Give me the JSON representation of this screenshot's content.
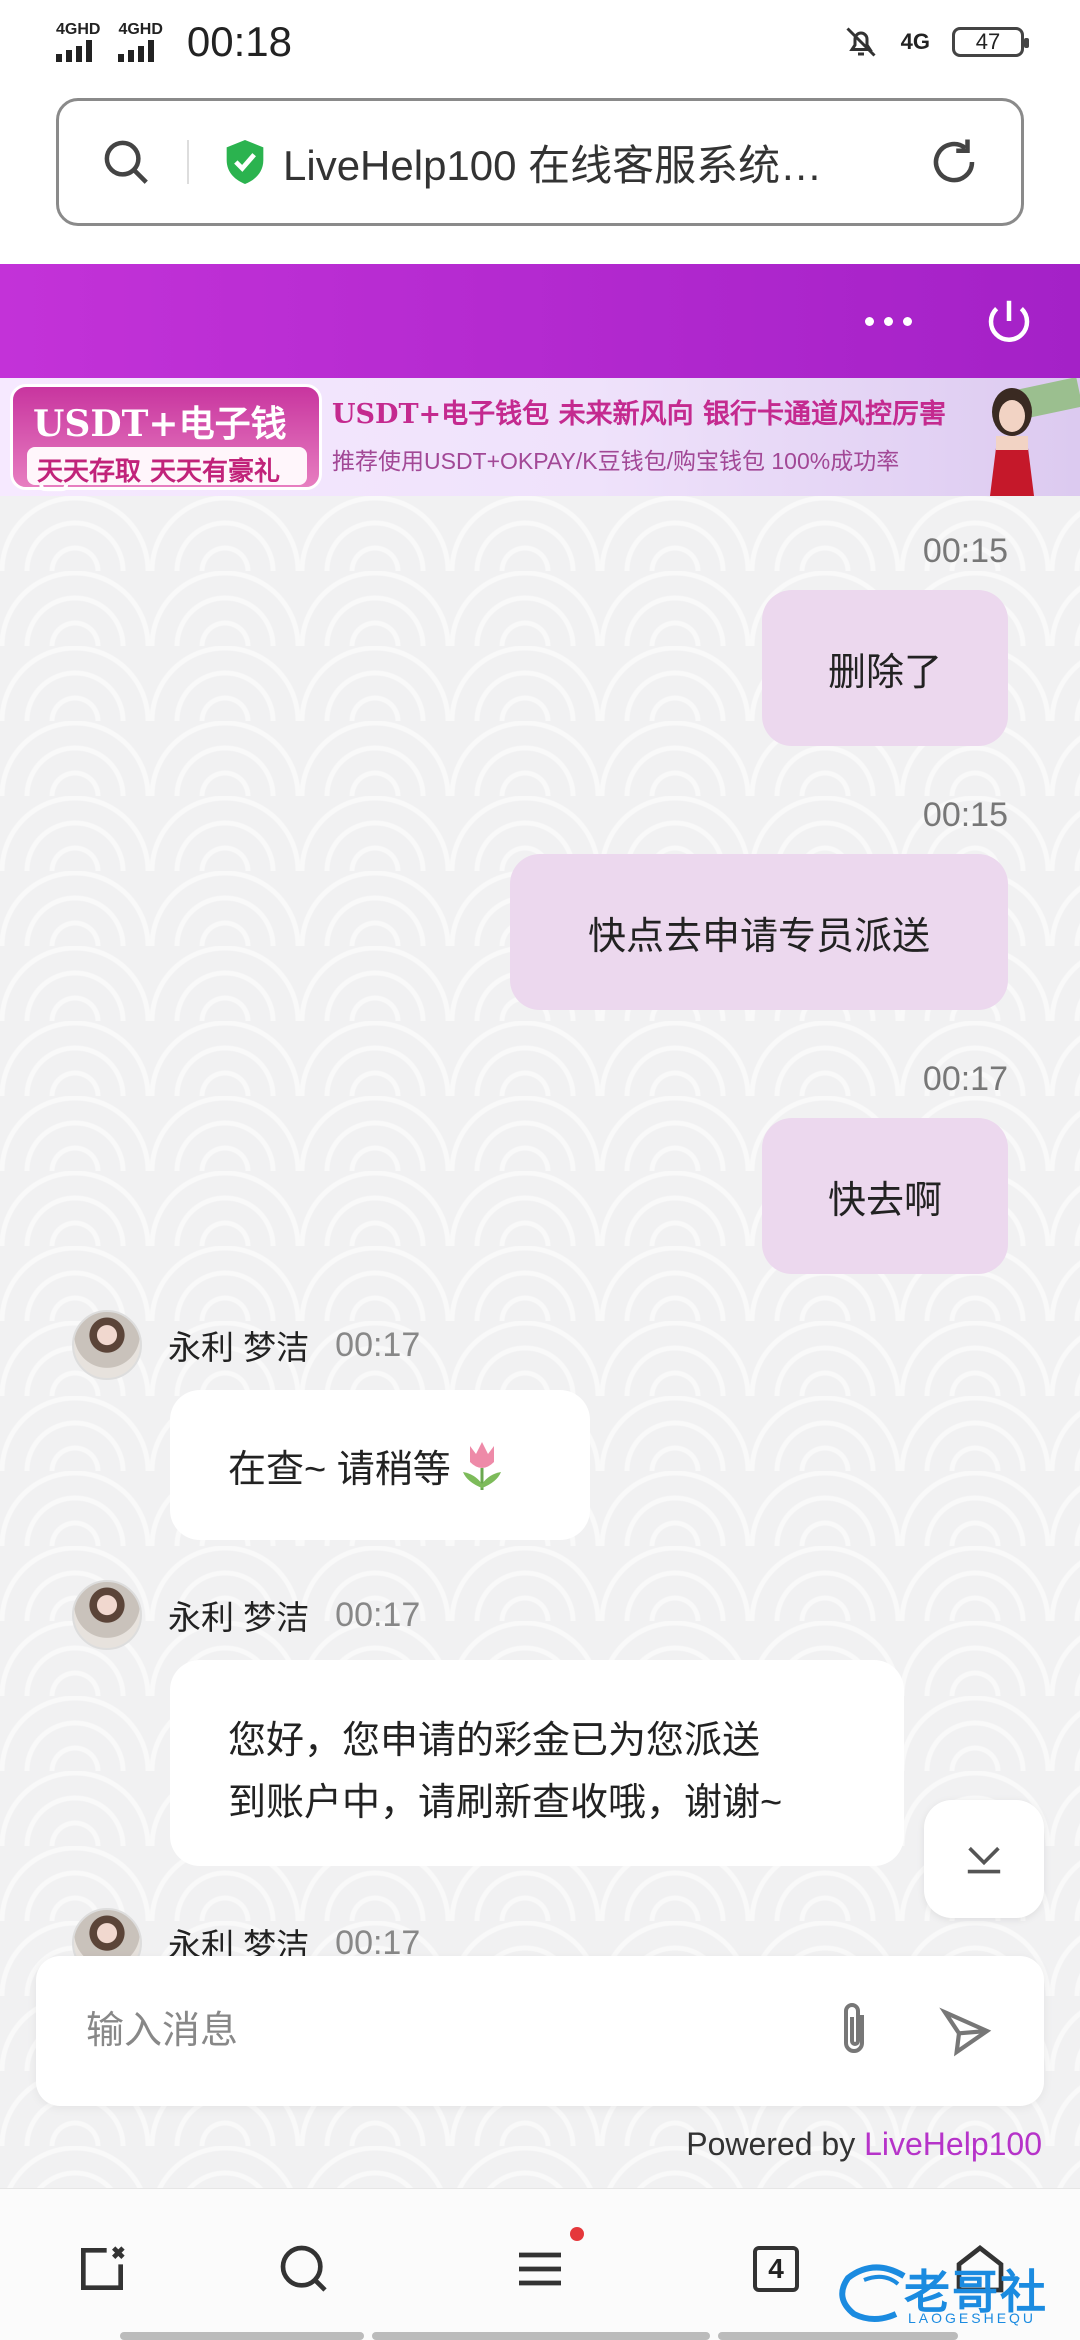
{
  "status_bar": {
    "signal1_label": "4GHD",
    "signal2_label": "4GHD",
    "time": "00:18",
    "network": "4G",
    "battery": "47"
  },
  "url_bar": {
    "title": "LiveHelp100 在线客服系统…",
    "secure_icon": "shield-check-icon",
    "secure_color": "#2bb34f"
  },
  "header": {
    "color_start": "#c332d8",
    "color_end": "#a421c7"
  },
  "ad": {
    "left_line1": "USDT+电子钱包",
    "left_line2": "天天存取 天天有豪礼",
    "mid_line1": "USDT+电子钱包  未来新风向  银行卡通道风控厉害",
    "mid_line2": "推荐使用USDT+OKPAY/K豆钱包/购宝钱包  100%成功率"
  },
  "messages": [
    {
      "side": "right",
      "time": "00:15",
      "text": "删除了"
    },
    {
      "side": "right",
      "time": "00:15",
      "text": "快点去申请专员派送"
    },
    {
      "side": "right",
      "time": "00:17",
      "text": "快去啊"
    },
    {
      "side": "left",
      "name": "永利 梦洁",
      "time": "00:17",
      "text": "在查~ 请稍等"
    },
    {
      "side": "left",
      "name": "永利 梦洁",
      "time": "00:17",
      "line1": "您好，您申请的彩金已为您派送",
      "line2": "到账户中，请刷新查收哦，谢谢~"
    },
    {
      "side": "left",
      "name": "永利 梦洁",
      "time": "00:17"
    }
  ],
  "input": {
    "placeholder": "输入消息"
  },
  "footer": {
    "powered_prefix": "Powered by ",
    "powered_brand": "LiveHelp100",
    "brand_color": "#b633c9"
  },
  "bottom_nav": {
    "tab_count": "4",
    "watermark_main": "老哥社区",
    "watermark_sub": "LAOGESHEQU"
  }
}
